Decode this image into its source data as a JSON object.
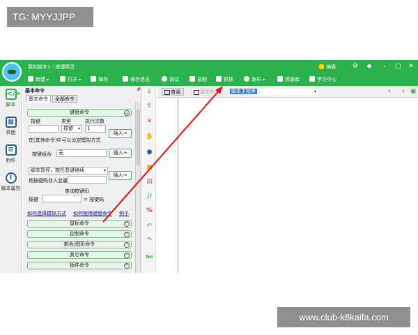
{
  "watermarks": {
    "top_left": "TG: MYYJJPP",
    "bottom_right": "www.club-k8kaifa.com"
  },
  "titlebar": {
    "title": "我的脚本1 - 按键精灵",
    "pro_label": "神盾"
  },
  "toolbar": {
    "new_label": "新建",
    "open_label": "打开",
    "save_label": "保存",
    "save_exit_label": "保存退出",
    "debug_label": "调试",
    "record_label": "录制",
    "capture_label": "抓抓",
    "publish_label": "发布",
    "resources_label": "资源库",
    "learn_label": "学习中心"
  },
  "left_nav": [
    {
      "label": "脚本",
      "icon": "script-icon"
    },
    {
      "label": "界面",
      "icon": "interface-icon"
    },
    {
      "label": "附件",
      "icon": "attachment-icon"
    },
    {
      "label": "脚本属性",
      "icon": "info-icon"
    }
  ],
  "panel": {
    "header": "基本命令",
    "tabs": [
      "基本命令",
      "全部命令"
    ],
    "keyboard_group": "键盘命令",
    "col_key": "按键",
    "col_type": "类型",
    "col_times": "执行次数",
    "type_value": "按键",
    "times_value": "1",
    "insert_label": "插入→",
    "other_cmd_label": "在[其他命令]中可以设定模拟方式",
    "combo_label": "按键组合",
    "combo_value": "无",
    "pause_value": "脚本暂停，按任意键继续",
    "save_code_label": "把按键码存入变量",
    "query_label": "查询按键码",
    "query_key_label": "按键",
    "query_code_label": "= 按键码",
    "link_sim_mode": "如何选择模拟方式",
    "link_keyboard": "如何使用键盘命令",
    "link_example": "例子",
    "groups": [
      "鼠标命令",
      "控制命令",
      "颜色/图形命令",
      "其它命令",
      "插件命令"
    ]
  },
  "editor": {
    "tab_normal": "普通",
    "tab_source": "源文件",
    "selector_value": "脚本主程序"
  }
}
